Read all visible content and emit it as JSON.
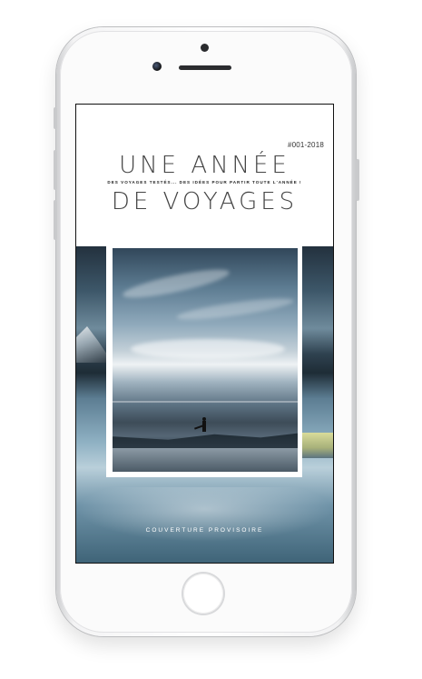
{
  "cover": {
    "code": "#001-2018",
    "title_line_1": "UNE ANNÉE",
    "subtitle": "DES VOYAGES TESTÉS... DES IDÉES POUR PARTIR TOUTE L'ANNÉE !",
    "title_line_2": "DE VOYAGES",
    "caption": "COUVERTURE PROVISOIRE"
  },
  "icons": {
    "camera": "camera-icon",
    "speaker": "speaker-icon",
    "home": "home-button-icon"
  },
  "colors": {
    "phone_body": "#ffffff",
    "screen_background": "#ffffff",
    "title_text": "#444444"
  }
}
